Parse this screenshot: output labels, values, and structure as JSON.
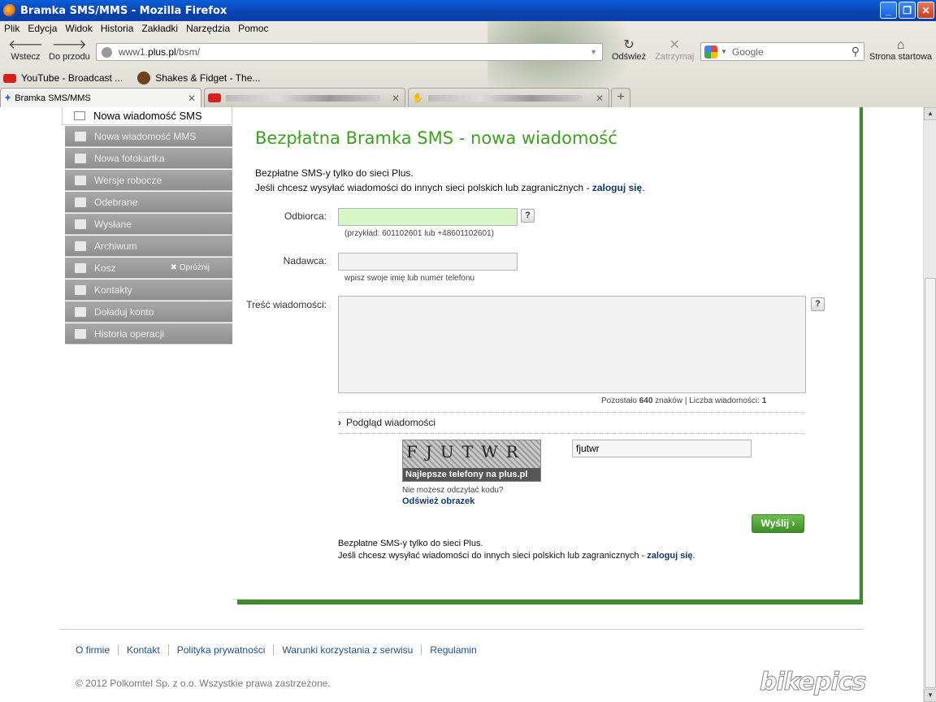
{
  "window": {
    "title": "Bramka SMS/MMS - Mozilla Firefox"
  },
  "menu": [
    "Plik",
    "Edycja",
    "Widok",
    "Historia",
    "Zakładki",
    "Narzędzia",
    "Pomoc"
  ],
  "nav": {
    "back": "Wstecz",
    "forward": "Do przodu",
    "reload": "Odśwież",
    "stop": "Zatrzymaj",
    "home": "Strona startowa",
    "url_prefix": "www1.",
    "url_domain": "plus.pl",
    "url_path": "/bsm/",
    "search_placeholder": "Google"
  },
  "bookmarks": [
    "YouTube - Broadcast ...",
    "Shakes & Fidget - The..."
  ],
  "tabs": {
    "active": "Bramka SMS/MMS"
  },
  "sidebar": {
    "active": "Nowa wiadomość SMS",
    "items": [
      "Nowa wiadomość MMS",
      "Nowa fotokartka",
      "Wersje robocze",
      "Odebrane",
      "Wysłane",
      "Archiwum",
      "Kosz",
      "Kontakty",
      "Doładuj konto",
      "Historia operacji"
    ],
    "empty_trash": "Opróżnij"
  },
  "form": {
    "heading": "Bezpłatna Bramka SMS - nowa wiadomość",
    "intro_line1": "Bezpłatne SMS-y tylko do sieci Plus.",
    "intro_line2": "Jeśli chcesz wysyłać wiadomości do innych sieci polskich lub zagranicznych - ",
    "login_link": "zaloguj się",
    "recipient_label": "Odbiorca:",
    "recipient_hint": "(przykład: 601102601 lub +48601102601)",
    "sender_label": "Nadawca:",
    "sender_hint": "wpisz swoje imię lub numer telefonu",
    "message_label": "Treść wiadomości:",
    "help": "?",
    "counter_prefix": "Pozostało",
    "chars_left": "640",
    "counter_mid": "znaków | Liczba wiadomości:",
    "messages_count": "1",
    "preview": "Podgląd wiadomości",
    "captcha_text": "FJUTWR",
    "captcha_banner": "Najlepsze telefony na plus.pl",
    "captcha_value": "fjutwr",
    "cant_read": "Nie możesz odczytać kodu?",
    "refresh_image": "Odśwież obrazek",
    "send": "Wyślij"
  },
  "footer": {
    "links": [
      "O firmie",
      "Kontakt",
      "Polityka prywatności",
      "Warunki korzystania z serwisu",
      "Regulamin"
    ],
    "copyright": "© 2012 Polkomtel Sp. z o.o. Wszystkie prawa zastrzeżone.",
    "watermark": "bikepics"
  }
}
